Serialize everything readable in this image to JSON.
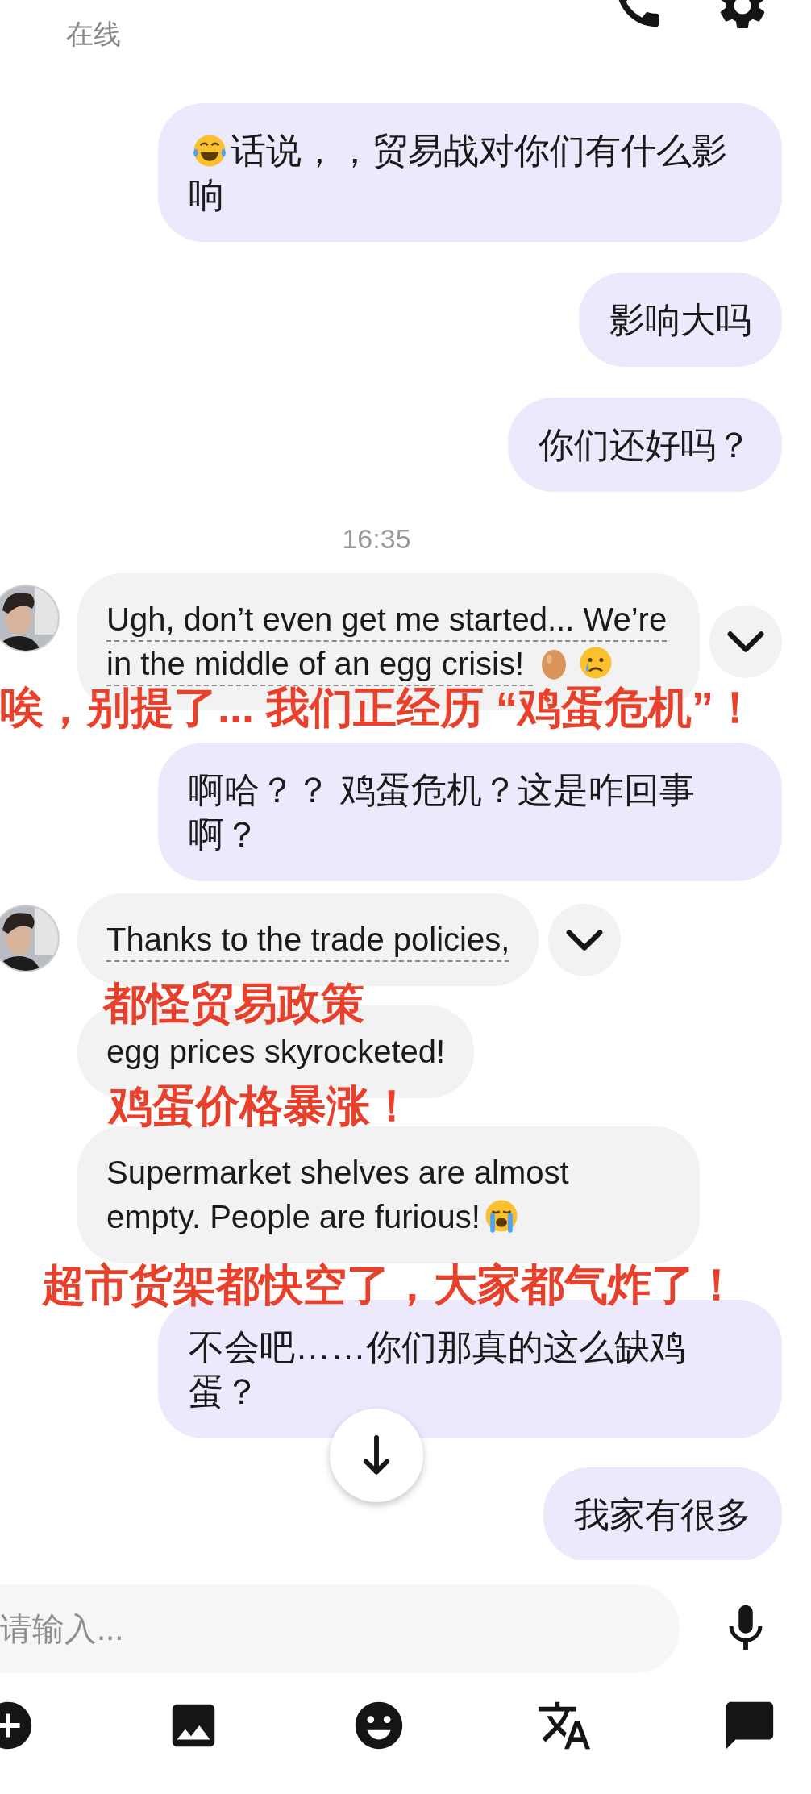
{
  "contact": {
    "status": "在线"
  },
  "messages": [
    {
      "kind": "sent",
      "text": "话说，，贸易战对你们有什么影响",
      "lead_emoji": [
        {
          "kind": "laugh"
        }
      ]
    },
    {
      "kind": "sent",
      "text": "影响大吗"
    },
    {
      "kind": "sent",
      "text": "你们还好吗？"
    },
    {
      "kind": "time",
      "text": "16:35"
    },
    {
      "kind": "received",
      "text": "Ugh, don’t even get me started... We’re in the middle of an egg crisis! ",
      "trail_emoji": [
        {
          "kind": "egg"
        },
        {
          "kind": "cry"
        }
      ],
      "avatar": true,
      "underlined": true,
      "menu": true
    },
    {
      "kind": "note",
      "text": "唉，别提了... 我们正经历 “鸡蛋危机”！"
    },
    {
      "kind": "sent",
      "text": "啊哈？？ 鸡蛋危机？这是咋回事啊？"
    },
    {
      "kind": "received",
      "text": "Thanks to the trade policies,",
      "avatar": true,
      "underlined": true,
      "menu": true
    },
    {
      "kind": "note",
      "text": "都怪贸易政策"
    },
    {
      "kind": "received",
      "text": "egg prices skyrocketed!",
      "avatar": false,
      "underlined": false,
      "menu": false
    },
    {
      "kind": "note",
      "text": "鸡蛋价格暴涨！"
    },
    {
      "kind": "received",
      "text": "Supermarket shelves are almost empty. People are furious!",
      "trail_emoji": [
        {
          "kind": "sob"
        }
      ],
      "avatar": false,
      "underlined": false,
      "menu": false
    },
    {
      "kind": "note",
      "text": "超市货架都快空了，大家都气炸了！"
    },
    {
      "kind": "sent",
      "text": "不会吧……你们那真的这么缺鸡蛋？"
    },
    {
      "kind": "sent",
      "text": "我家有很多"
    }
  ],
  "input": {
    "placeholder": "请输入..."
  }
}
